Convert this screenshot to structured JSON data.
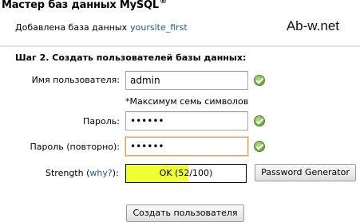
{
  "header": {
    "title": "Мастер баз данных MySQL",
    "title_mark": "®",
    "added_label": "Добавлена база данных",
    "database_name": "yoursite_first",
    "watermark": "Ab-w.net"
  },
  "form": {
    "step_title": "Шаг 2. Создать пользователей базы данных:",
    "username_label": "Имя пользователя:",
    "username_value": "admin",
    "username_hint": "*Максимум семь символов",
    "password_label": "Пароль:",
    "password_value": "••••••",
    "password_confirm_label": "Пароль (повторно):",
    "password_confirm_value": "••••••",
    "strength_label": "Strength",
    "strength_link": "why?",
    "strength_text": "OK (52/100)",
    "strength_percent": 52,
    "strength_color": "#f0ff33",
    "password_generator_button": "Password Generator",
    "create_user_button": "Создать пользователя"
  },
  "icons": {
    "valid": "check-icon"
  }
}
